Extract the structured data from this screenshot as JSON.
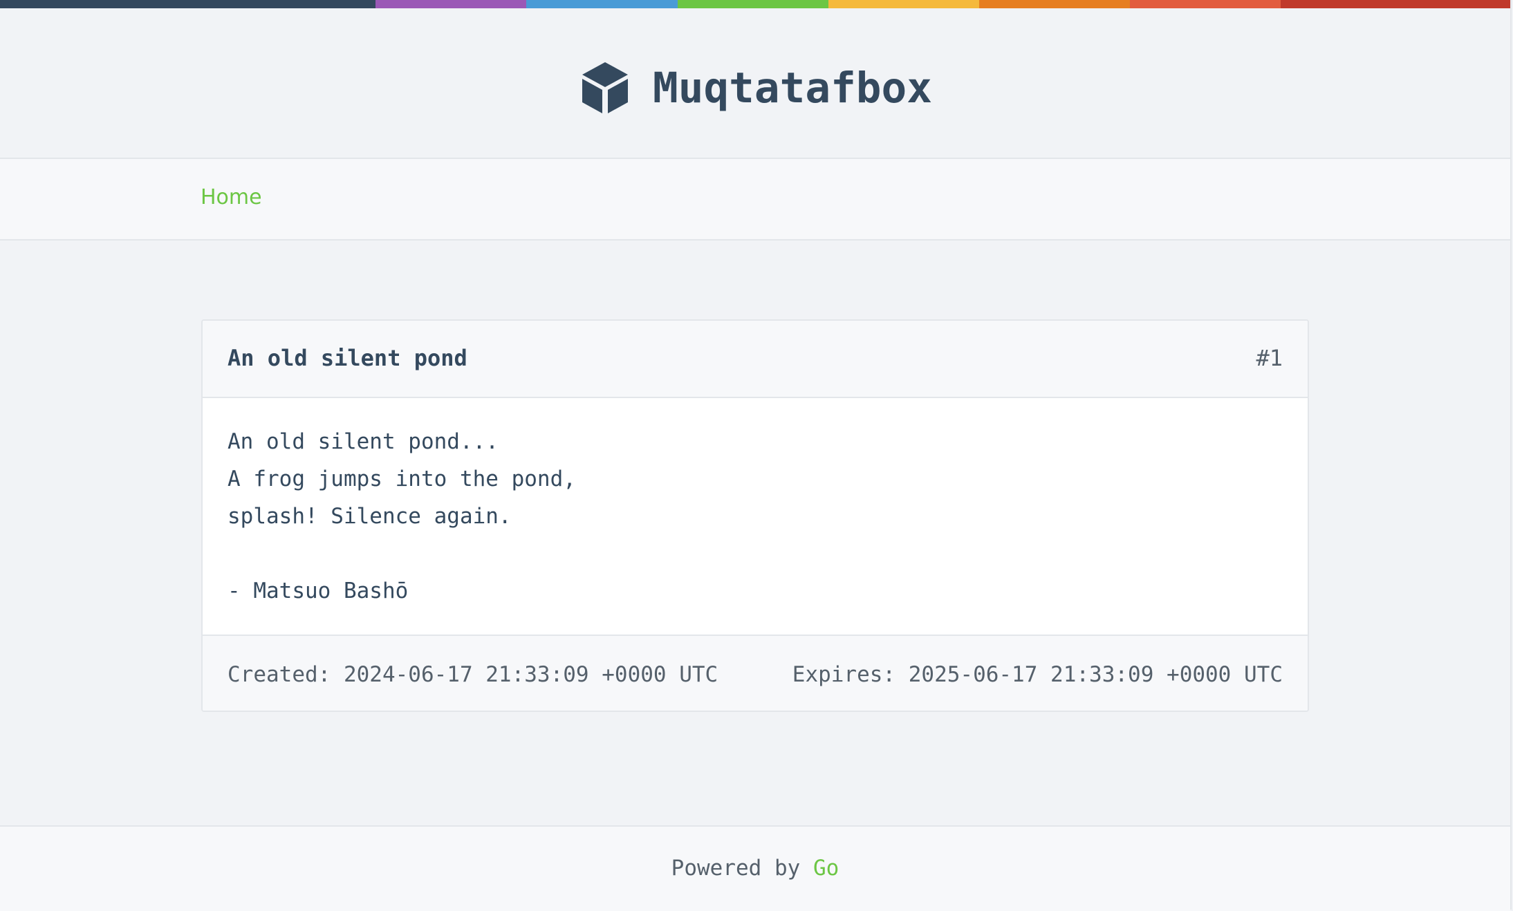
{
  "colors": {
    "top_bar": [
      "#34495e",
      "#9b59b6",
      "#4a9bd6",
      "#6cc644",
      "#f5b93d",
      "#e67e22",
      "#e25c3f",
      "#c0392b"
    ],
    "accent": "#6cc644",
    "text": "#34495e"
  },
  "header": {
    "icon": "cube-icon",
    "title": "Muqtatafbox"
  },
  "nav": {
    "home_label": "Home"
  },
  "paste": {
    "title": "An old silent pond",
    "id": "#1",
    "content": "An old silent pond...\nA frog jumps into the pond,\nsplash! Silence again.\n\n- Matsuo Bashō",
    "created": "Created: 2024-06-17 21:33:09 +0000 UTC",
    "expires": "Expires: 2025-06-17 21:33:09 +0000 UTC"
  },
  "footer": {
    "prefix": "Powered by ",
    "link_label": "Go"
  }
}
